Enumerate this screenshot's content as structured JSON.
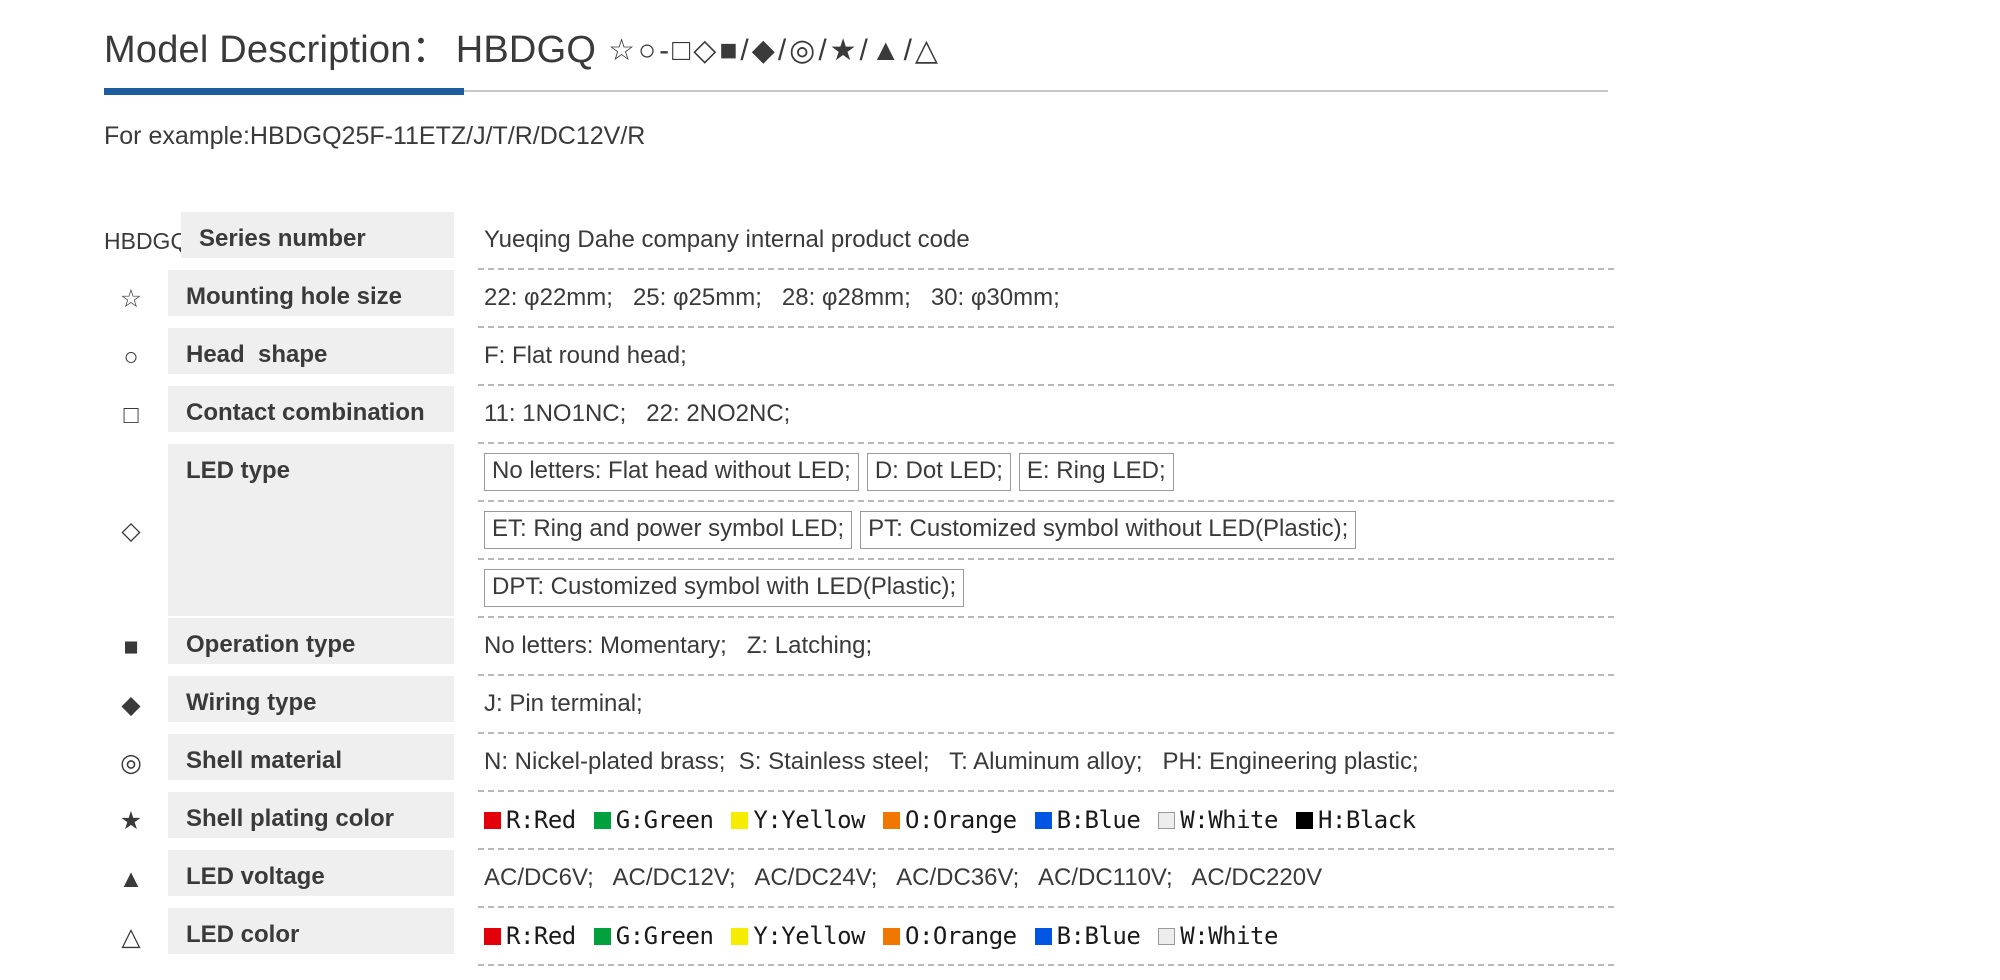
{
  "header": {
    "title": "Model Description：",
    "code": "HBDGQ",
    "symbols": "☆○-□◇■/◆/◎/★/▲/△",
    "example": "For example:HBDGQ25F-11ETZ/J/T/R/DC12V/R"
  },
  "colors": {
    "accent_blue": "#1F5C9E",
    "rule_grey": "#C8C8C8",
    "label_bg": "#EFEFEF",
    "red": "#E3000B",
    "green": "#00A03C",
    "yellow": "#F5EC00",
    "orange": "#F07800",
    "blue": "#0055E3",
    "white": "#EDEDED",
    "black": "#000000"
  },
  "rows": [
    {
      "symbol": "HBDGQ",
      "symbol_kind": "text",
      "label": "Series number",
      "lines": [
        {
          "text": "Yueqing Dahe company internal product code"
        }
      ]
    },
    {
      "symbol": "☆",
      "symbol_kind": "glyph",
      "label": "Mounting hole size",
      "lines": [
        {
          "text": "22: φ22mm;   25: φ25mm;   28: φ28mm;   30: φ30mm;"
        }
      ]
    },
    {
      "symbol": "○",
      "symbol_kind": "glyph",
      "label": "Head  shape",
      "lines": [
        {
          "text": "F: Flat round head;"
        }
      ]
    },
    {
      "symbol": "□",
      "symbol_kind": "glyph",
      "label": "Contact combination",
      "lines": [
        {
          "text": "11: 1NO1NC;   22: 2NO2NC;"
        }
      ]
    },
    {
      "symbol": "◇",
      "symbol_kind": "glyph",
      "label": "LED type",
      "boxed_lines": [
        [
          "No letters: Flat head without LED;",
          "D: Dot LED;",
          "E: Ring LED;"
        ],
        [
          "ET: Ring and power symbol LED;",
          "PT: Customized symbol without LED(Plastic);"
        ],
        [
          "DPT: Customized symbol with LED(Plastic);"
        ]
      ]
    },
    {
      "symbol": "■",
      "symbol_kind": "glyph",
      "label": "Operation type",
      "lines": [
        {
          "text": "No letters: Momentary;   Z: Latching;"
        }
      ]
    },
    {
      "symbol": "◆",
      "symbol_kind": "glyph",
      "label": "Wiring type",
      "lines": [
        {
          "text": "J: Pin terminal;"
        }
      ]
    },
    {
      "symbol": "◎",
      "symbol_kind": "glyph",
      "label": "Shell material",
      "lines": [
        {
          "text": "N: Nickel-plated brass;  S: Stainless steel;   T: Aluminum alloy;   PH: Engineering plastic;"
        }
      ]
    },
    {
      "symbol": "★",
      "symbol_kind": "glyph",
      "label": "Shell plating color",
      "swatches": [
        {
          "label": "R:Red",
          "color": "#E3000B",
          "bordered": false
        },
        {
          "label": "G:Green",
          "color": "#00A03C",
          "bordered": false
        },
        {
          "label": "Y:Yellow",
          "color": "#F5EC00",
          "bordered": false
        },
        {
          "label": "O:Orange",
          "color": "#F07800",
          "bordered": false
        },
        {
          "label": "B:Blue",
          "color": "#0055E3",
          "bordered": false
        },
        {
          "label": "W:White",
          "color": "#EDEDED",
          "bordered": true
        },
        {
          "label": "H:Black",
          "color": "#000000",
          "bordered": false
        }
      ]
    },
    {
      "symbol": "▲",
      "symbol_kind": "glyph",
      "label": "LED voltage",
      "lines": [
        {
          "text": "AC/DC6V;   AC/DC12V;   AC/DC24V;   AC/DC36V;   AC/DC110V;   AC/DC220V"
        }
      ]
    },
    {
      "symbol": "△",
      "symbol_kind": "glyph",
      "label": "LED color",
      "swatches": [
        {
          "label": "R:Red",
          "color": "#E3000B",
          "bordered": false
        },
        {
          "label": "G:Green",
          "color": "#00A03C",
          "bordered": false
        },
        {
          "label": "Y:Yellow",
          "color": "#F5EC00",
          "bordered": false
        },
        {
          "label": "O:Orange",
          "color": "#F07800",
          "bordered": false
        },
        {
          "label": "B:Blue",
          "color": "#0055E3",
          "bordered": false
        },
        {
          "label": "W:White",
          "color": "#EDEDED",
          "bordered": true
        }
      ]
    }
  ]
}
